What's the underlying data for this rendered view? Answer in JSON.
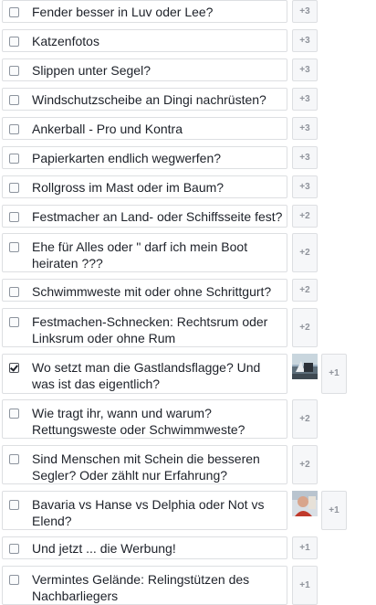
{
  "poll": {
    "options": [
      {
        "label": "Fender besser in Luv oder Lee?",
        "votes": "+3",
        "checked": false,
        "avatar": null
      },
      {
        "label": "Katzenfotos",
        "votes": "+3",
        "checked": false,
        "avatar": null
      },
      {
        "label": "Slippen unter Segel?",
        "votes": "+3",
        "checked": false,
        "avatar": null
      },
      {
        "label": "Windschutzscheibe an Dingi nachrüsten?",
        "votes": "+3",
        "checked": false,
        "avatar": null
      },
      {
        "label": "Ankerball - Pro und Kontra",
        "votes": "+3",
        "checked": false,
        "avatar": null
      },
      {
        "label": "Papierkarten endlich wegwerfen?",
        "votes": "+3",
        "checked": false,
        "avatar": null
      },
      {
        "label": "Rollgross im Mast oder im Baum?",
        "votes": "+3",
        "checked": false,
        "avatar": null
      },
      {
        "label": "Festmacher an Land- oder Schiffsseite fest?",
        "votes": "+2",
        "checked": false,
        "avatar": null
      },
      {
        "label": "Ehe für Alles oder \" darf ich mein Boot heiraten ???",
        "votes": "+2",
        "checked": false,
        "avatar": null
      },
      {
        "label": "Schwimmweste mit oder ohne Schrittgurt?",
        "votes": "+2",
        "checked": false,
        "avatar": null
      },
      {
        "label": "Festmachen-Schnecken: Rechtsrum oder Linksrum oder ohne Rum",
        "votes": "+2",
        "checked": false,
        "avatar": null
      },
      {
        "label": "Wo setzt man die Gastlandsflagge? Und was ist das eigentlich?",
        "votes": "+1",
        "checked": true,
        "avatar": "boat-photo"
      },
      {
        "label": "Wie tragt ihr, wann und warum? Rettungsweste oder Schwimmweste?",
        "votes": "+2",
        "checked": false,
        "avatar": null
      },
      {
        "label": "Sind Menschen mit Schein die besseren Segler? Oder zählt nur Erfahrung?",
        "votes": "+2",
        "checked": false,
        "avatar": null
      },
      {
        "label": "Bavaria vs Hanse vs Delphia oder Not vs Elend?",
        "votes": "+1",
        "checked": false,
        "avatar": "person-photo"
      },
      {
        "label": "Und jetzt ... die Werbung!",
        "votes": "+1",
        "checked": false,
        "avatar": null
      },
      {
        "label": "Vermintes Gelände: Relingstützen des Nachbarliegers",
        "votes": "+1",
        "checked": false,
        "avatar": null
      }
    ]
  },
  "colors": {
    "border": "#dddfe2",
    "count_text": "#90949c",
    "label_text": "#1d2129"
  }
}
